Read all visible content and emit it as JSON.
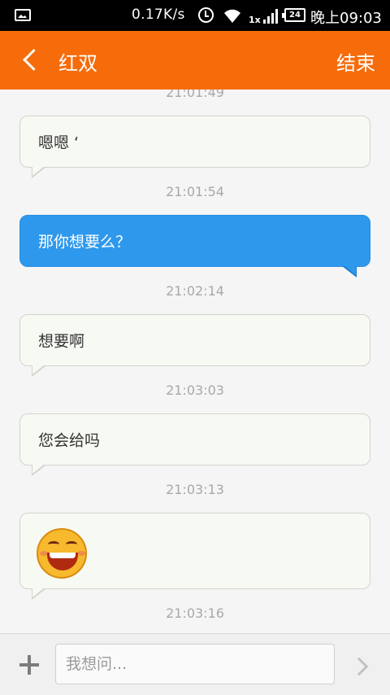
{
  "status_bar": {
    "network_speed": "0.17K/s",
    "signal_label": "1x",
    "battery_level": "24",
    "time": "晚上09:03",
    "icons": [
      "image-icon",
      "alarm-icon",
      "wifi-icon",
      "signal-icon",
      "battery-icon"
    ]
  },
  "header": {
    "title": "红双",
    "end_label": "结束",
    "back_icon": "chevron-left-icon",
    "background_color": "#f66c0b"
  },
  "messages": [
    {
      "type": "timestamp",
      "text": "21:01:49"
    },
    {
      "type": "incoming",
      "text": "嗯嗯 ‘"
    },
    {
      "type": "timestamp",
      "text": "21:01:54"
    },
    {
      "type": "outgoing",
      "text": "那你想要么？"
    },
    {
      "type": "timestamp",
      "text": "21:02:14"
    },
    {
      "type": "incoming",
      "text": "想要啊"
    },
    {
      "type": "timestamp",
      "text": "21:03:03"
    },
    {
      "type": "incoming",
      "text": "您会给吗"
    },
    {
      "type": "timestamp",
      "text": "21:03:13"
    },
    {
      "type": "incoming_emoji",
      "icon": "laughing-emoji-icon"
    },
    {
      "type": "timestamp",
      "text": "21:03:16"
    }
  ],
  "colors": {
    "outgoing_bubble": "#2e98ec",
    "incoming_bubble": "#f7faf3",
    "timestamp_text": "#a8a8a8"
  },
  "input_bar": {
    "placeholder": "我想问...",
    "value": "",
    "plus_icon": "plus-icon",
    "send_icon": "chevron-right-icon"
  }
}
